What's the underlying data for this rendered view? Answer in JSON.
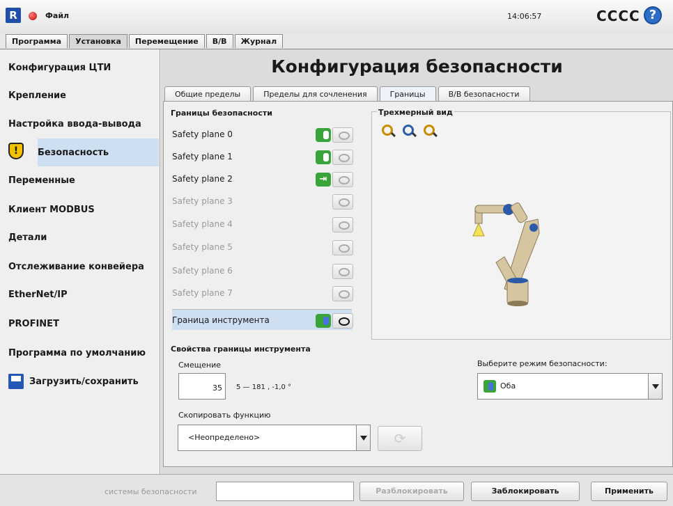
{
  "header": {
    "file_menu": "Файл",
    "clock": "14:06:57",
    "robot_name": "CCCC",
    "help": "?"
  },
  "main_tabs": [
    "Программа",
    "Установка",
    "Перемещение",
    "В/В",
    "Журнал"
  ],
  "sidebar": {
    "items": [
      "Конфигурация ЦТИ",
      "Крепление",
      "Настройка ввода-вывода",
      "Безопасность",
      "Переменные",
      "Клиент MODBUS",
      "Детали",
      "Отслеживание конвейера",
      "EtherNet/IP",
      "PROFINET",
      "Программа по умолчанию",
      "Загрузить/сохранить"
    ]
  },
  "page": {
    "title": "Конфигурация безопасности",
    "sub_tabs": [
      "Общие пределы",
      "Пределы для сочленения",
      "Границы",
      "В/В безопасности"
    ]
  },
  "boundaries": {
    "label": "Границы безопасности",
    "planes": [
      "Safety plane 0",
      "Safety plane 1",
      "Safety plane 2",
      "Safety plane 3",
      "Safety plane 4",
      "Safety plane 5",
      "Safety plane 6",
      "Safety plane 7"
    ],
    "tool_boundary": "Граница инструмента",
    "exit_glyph": "⇥"
  },
  "view3d": {
    "label": "Трехмерный вид"
  },
  "tool_props": {
    "label": "Свойства границы инструмента",
    "offset_label": "Смещение",
    "offset_value": "35",
    "offset_range": "5 — 181 , -1,0 °",
    "mode_label": "Выберите режим безопасности:",
    "mode_value": "Оба",
    "copy_label": "Скопировать функцию",
    "copy_value": "<Неопределено>",
    "refresh_glyph": "⟳"
  },
  "footer": {
    "label": "системы безопасности",
    "unlock": "Разблокировать",
    "lock": "Заблокировать",
    "apply": "Применить"
  },
  "colors": {
    "accent_blue": "#2d6ec8",
    "toggle_green": "#3aa43a",
    "selection": "#cfdff2"
  }
}
